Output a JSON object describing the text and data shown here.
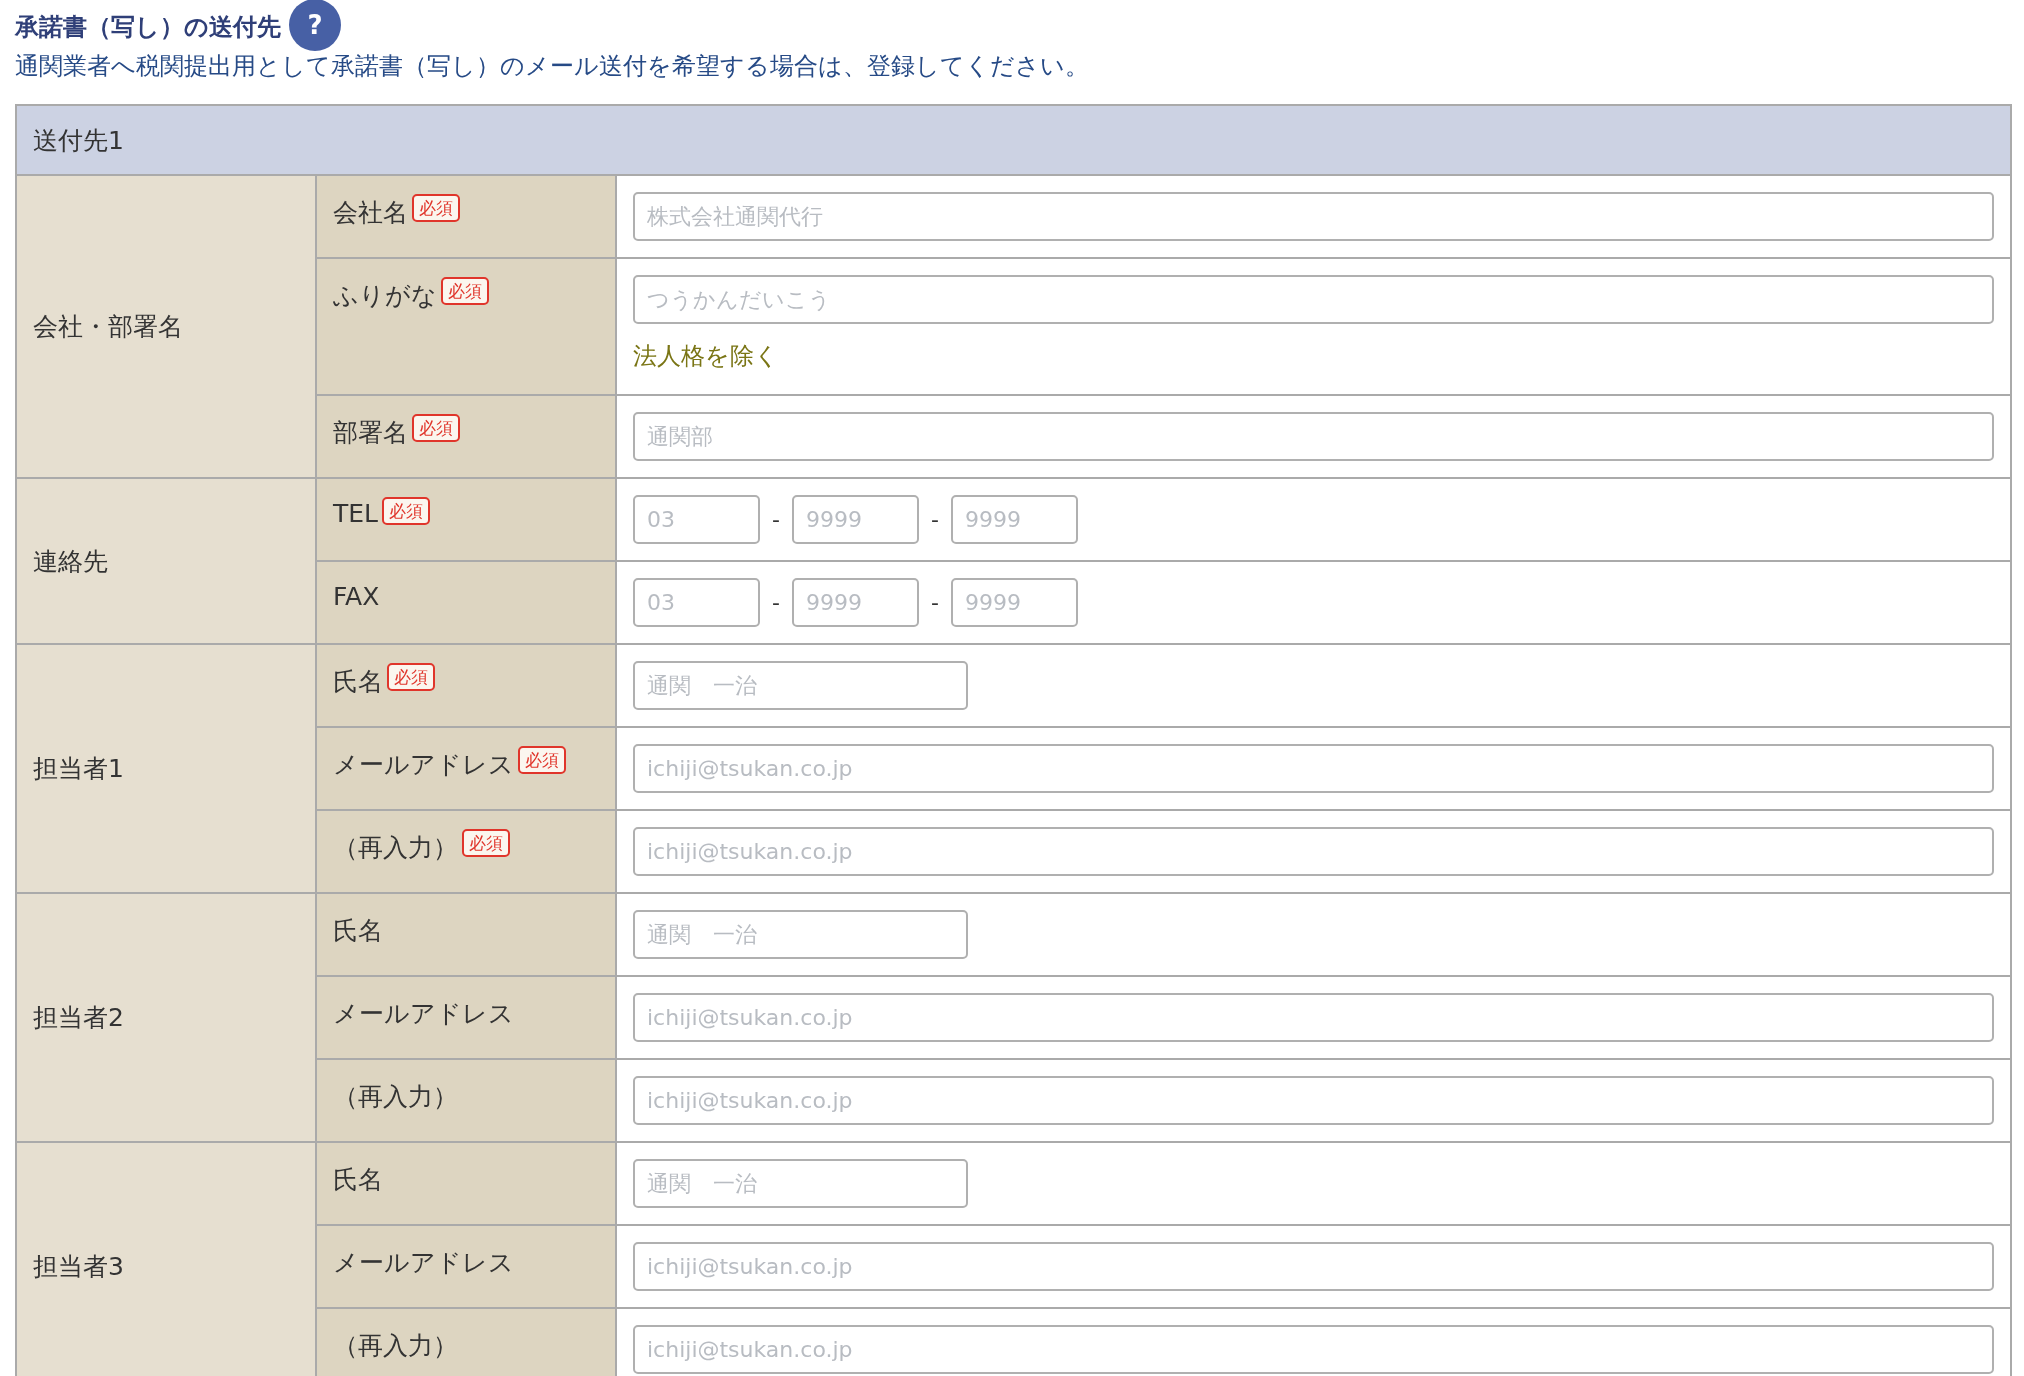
{
  "heading": {
    "title": "承諾書（写し）の送付先",
    "help": "?"
  },
  "description": "通関業者へ税関提出用として承諾書（写し）のメール送付を希望する場合は、登録してください。",
  "table": {
    "title": "送付先1",
    "sections": [
      {
        "label": "会社・部署名",
        "fields": [
          {
            "kind": "text",
            "label": "会社名",
            "badge": "必須",
            "placeholder": "株式会社通関代行"
          },
          {
            "kind": "text",
            "label": "ふりがな",
            "badge": "必須",
            "placeholder": "つうかんだいこう",
            "note": "法人格を除く"
          },
          {
            "kind": "text",
            "label": "部署名",
            "badge": "必須",
            "placeholder": "通関部"
          }
        ]
      },
      {
        "label": "連絡先",
        "fields": [
          {
            "kind": "phone",
            "label": "TEL",
            "badge": "必須",
            "parts": [
              {
                "placeholder": "03"
              },
              {
                "placeholder": "9999"
              },
              {
                "placeholder": "9999"
              }
            ],
            "separators": [
              "-",
              "-"
            ]
          },
          {
            "kind": "phone",
            "label": "FAX",
            "parts": [
              {
                "placeholder": "03"
              },
              {
                "placeholder": "9999"
              },
              {
                "placeholder": "9999"
              }
            ],
            "separators": [
              "-",
              "-"
            ]
          }
        ]
      },
      {
        "label": "担当者1",
        "fields": [
          {
            "kind": "short",
            "label": "氏名",
            "badge": "必須",
            "placeholder": "通関　一治"
          },
          {
            "kind": "text",
            "label": "メールアドレス",
            "badge": "必須",
            "placeholder": "ichiji@tsukan.co.jp"
          },
          {
            "kind": "text",
            "label": "（再入力）",
            "badge": "必須",
            "placeholder": "ichiji@tsukan.co.jp"
          }
        ]
      },
      {
        "label": "担当者2",
        "fields": [
          {
            "kind": "short",
            "label": "氏名",
            "placeholder": "通関　一治"
          },
          {
            "kind": "text",
            "label": "メールアドレス",
            "placeholder": "ichiji@tsukan.co.jp"
          },
          {
            "kind": "text",
            "label": "（再入力）",
            "placeholder": "ichiji@tsukan.co.jp"
          }
        ]
      },
      {
        "label": "担当者3",
        "fields": [
          {
            "kind": "short",
            "label": "氏名",
            "placeholder": "通関　一治"
          },
          {
            "kind": "text",
            "label": "メールアドレス",
            "placeholder": "ichiji@tsukan.co.jp"
          },
          {
            "kind": "text",
            "label": "（再入力）",
            "placeholder": "ichiji@tsukan.co.jp"
          }
        ]
      }
    ]
  }
}
